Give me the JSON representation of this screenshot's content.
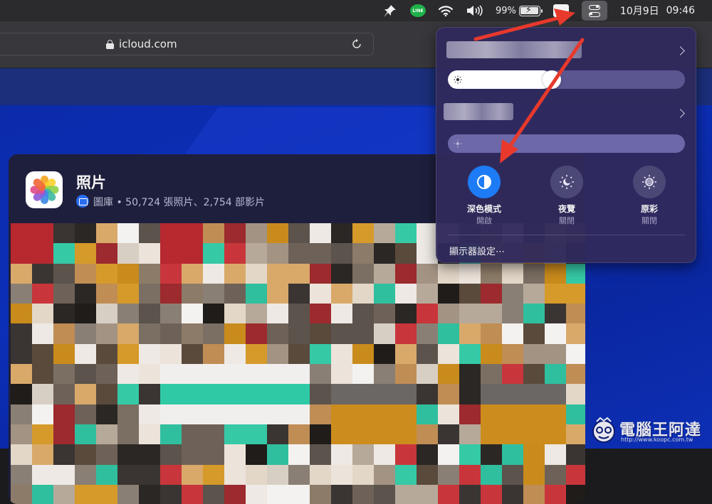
{
  "menubar": {
    "line_label": "LINE",
    "battery_percent": "99%",
    "date": "10月9日",
    "time": "09:46"
  },
  "browser": {
    "url": "icloud.com"
  },
  "photos_card": {
    "title": "照片",
    "subtitle": "圖庫 • 50,724 張照片、2,754 部影片"
  },
  "control_center": {
    "brightness_level": 0.4,
    "external_brightness_level": 0.0,
    "modes": [
      {
        "label": "深色模式",
        "state": "開啟",
        "active": true,
        "icon": "dark-mode-icon"
      },
      {
        "label": "夜覽",
        "state": "關閉",
        "active": false,
        "icon": "night-shift-icon"
      },
      {
        "label": "原彩",
        "state": "關閉",
        "active": false,
        "icon": "true-tone-icon"
      }
    ],
    "settings_label": "顯示器設定⋯"
  },
  "watermark": {
    "text": "電腦王阿達",
    "url": "http://www.koopc.com.tw"
  },
  "colors": {
    "accent": "#1d7cf5",
    "arrow": "#e8392c",
    "page_blue": "#0c2fb8",
    "panel": "#302a5c"
  }
}
